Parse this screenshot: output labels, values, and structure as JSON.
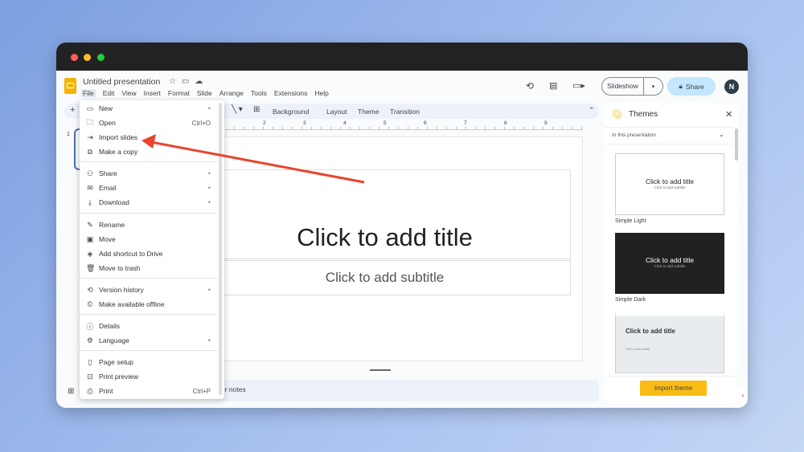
{
  "app": {
    "title": "Untitled presentation",
    "menus": [
      "File",
      "Edit",
      "View",
      "Insert",
      "Format",
      "Slide",
      "Arrange",
      "Tools",
      "Extensions",
      "Help"
    ]
  },
  "header": {
    "slideshow": "Slideshow",
    "share": "Share",
    "avatar": "N"
  },
  "toolbar": {
    "items": [
      "Background",
      "Layout",
      "Theme",
      "Transition"
    ]
  },
  "ruler": [
    "2",
    "3",
    "4",
    "5",
    "6",
    "7",
    "8",
    "9"
  ],
  "filmstrip": {
    "slide_number": "1"
  },
  "slide": {
    "title": "Click to add title",
    "subtitle": "Click to add subtitle"
  },
  "notes": {
    "text": "er notes"
  },
  "file_menu": {
    "items": [
      {
        "label": "New",
        "icon": "new-icon",
        "shortcut": "",
        "submenu": true
      },
      {
        "label": "Open",
        "icon": "folder-icon",
        "shortcut": "Ctrl+O",
        "submenu": false
      },
      {
        "label": "Import slides",
        "icon": "import-icon",
        "shortcut": "",
        "submenu": false
      },
      {
        "label": "Make a copy",
        "icon": "copy-icon",
        "shortcut": "",
        "submenu": false
      },
      {
        "label": "Share",
        "icon": "share-person-icon",
        "shortcut": "",
        "submenu": true
      },
      {
        "label": "Email",
        "icon": "email-icon",
        "shortcut": "",
        "submenu": true
      },
      {
        "label": "Download",
        "icon": "download-icon",
        "shortcut": "",
        "submenu": true
      },
      {
        "label": "Rename",
        "icon": "rename-icon",
        "shortcut": "",
        "submenu": false
      },
      {
        "label": "Move",
        "icon": "move-folder-icon",
        "shortcut": "",
        "submenu": false
      },
      {
        "label": "Add shortcut to Drive",
        "icon": "drive-shortcut-icon",
        "shortcut": "",
        "submenu": false
      },
      {
        "label": "Move to trash",
        "icon": "trash-icon",
        "shortcut": "",
        "submenu": false
      },
      {
        "label": "Version history",
        "icon": "history-icon",
        "shortcut": "",
        "submenu": true
      },
      {
        "label": "Make available offline",
        "icon": "offline-icon",
        "shortcut": "",
        "submenu": false
      },
      {
        "label": "Details",
        "icon": "info-icon",
        "shortcut": "",
        "submenu": false
      },
      {
        "label": "Language",
        "icon": "globe-icon",
        "shortcut": "",
        "submenu": true
      },
      {
        "label": "Page setup",
        "icon": "page-setup-icon",
        "shortcut": "",
        "submenu": false
      },
      {
        "label": "Print preview",
        "icon": "print-preview-icon",
        "shortcut": "",
        "submenu": false
      },
      {
        "label": "Print",
        "icon": "print-icon",
        "shortcut": "Ctrl+P",
        "submenu": false
      }
    ]
  },
  "themes": {
    "title": "Themes",
    "section": "In this presentation",
    "cards": [
      {
        "name": "Simple Light",
        "title": "Click to add title",
        "subtitle": "Click to add subtitle"
      },
      {
        "name": "Simple Dark",
        "title": "Click to add title",
        "subtitle": "Click to add subtitle"
      },
      {
        "name": "",
        "title": "Click to add title",
        "subtitle": "Click to add subtitle"
      }
    ],
    "import": "Import theme"
  },
  "colors": {
    "accent": "#1a73e8",
    "arrow": "#e8452c",
    "import_button": "#f9bc15",
    "share_bg": "#c2e7ff"
  }
}
